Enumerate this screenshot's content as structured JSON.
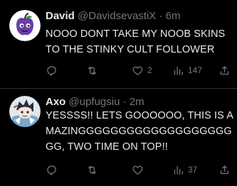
{
  "colors": {
    "background": "#000000",
    "text": "#e7e9ea",
    "secondary": "#71767b",
    "divider": "#2f3336"
  },
  "tweets": [
    {
      "display_name": "David",
      "handle": "@DavidsevastiX",
      "separator": "·",
      "time": "6m",
      "text": "NOOO DONT TAKE MY NOOB SKINS TO THE STINKY CULT FOLLOWER",
      "avatar_icon": "purple-apple-avatar",
      "replies": "",
      "retweets": "",
      "likes": "2",
      "views": "147"
    },
    {
      "display_name": "Axo",
      "handle": "@upfugsiu",
      "separator": "·",
      "time": "2m",
      "text": "YESSSS!! LETS GOOOOOO, THIS IS AMAZINGGGGGGGGGGGGGGGGGGGGG, TWO TIME ON TOP!!",
      "avatar_icon": "anime-character-avatar",
      "replies": "",
      "retweets": "",
      "likes": "",
      "views": "37"
    }
  ]
}
